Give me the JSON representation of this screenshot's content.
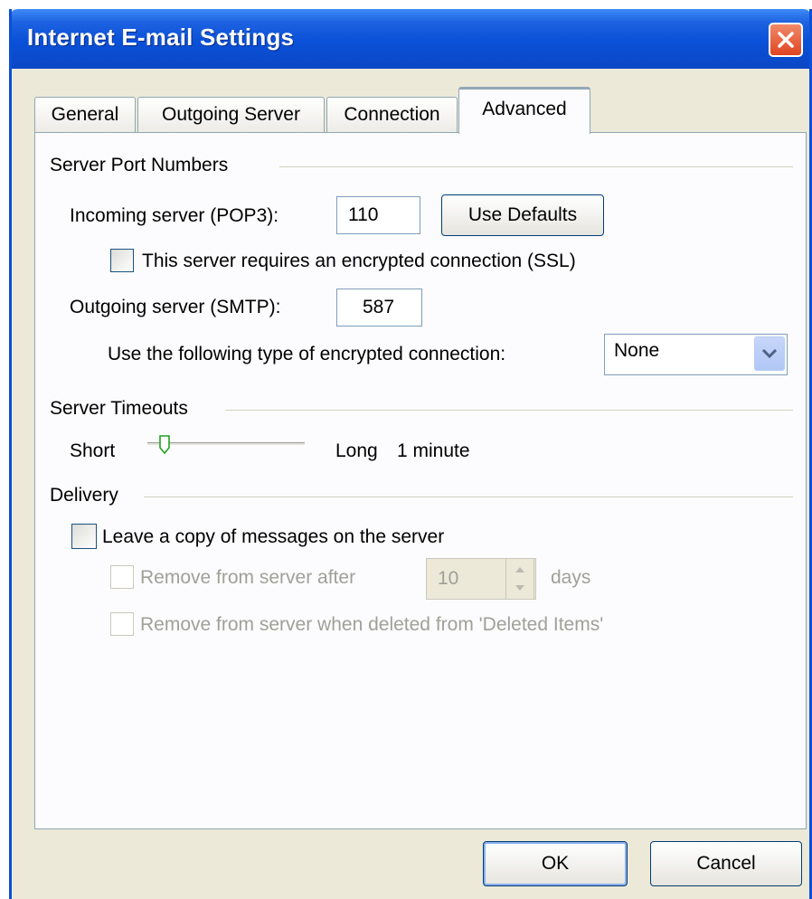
{
  "window": {
    "title": "Internet E-mail Settings"
  },
  "tabs": [
    {
      "label": "General"
    },
    {
      "label": "Outgoing Server"
    },
    {
      "label": "Connection"
    },
    {
      "label": "Advanced",
      "active": true
    }
  ],
  "port_numbers": {
    "heading": "Server Port Numbers",
    "incoming_label": "Incoming server (POP3):",
    "incoming_value": "110",
    "use_defaults_label": "Use Defaults",
    "ssl_checkbox_label": "This server requires an encrypted connection (SSL)",
    "ssl_checked": false,
    "outgoing_label": "Outgoing server (SMTP):",
    "outgoing_value": "587",
    "encryption_label": "Use the following type of encrypted connection:",
    "encryption_value": "None"
  },
  "timeouts": {
    "heading": "Server Timeouts",
    "short_label": "Short",
    "long_label": "Long",
    "value_text": "1 minute",
    "slider_position": 0.08
  },
  "delivery": {
    "heading": "Delivery",
    "leave_copy_label": "Leave a copy of messages on the server",
    "leave_copy_checked": false,
    "remove_after_label": "Remove from server after",
    "remove_after_days": "10",
    "days_label": "days",
    "remove_deleted_label": "Remove from server when deleted from 'Deleted Items'"
  },
  "footer": {
    "ok_label": "OK",
    "cancel_label": "Cancel"
  },
  "colors": {
    "titlebar": "#0a50d8",
    "dialog_bg": "#ece9d8",
    "panel_bg": "#fcfcfe",
    "active_tab_accent": "#ffc73c",
    "close_button": "#e04420"
  },
  "icons": {
    "close": "close-x-icon",
    "dropdown": "chevron-down-icon",
    "spinner_up": "spin-up-icon",
    "spinner_down": "spin-down-icon"
  }
}
